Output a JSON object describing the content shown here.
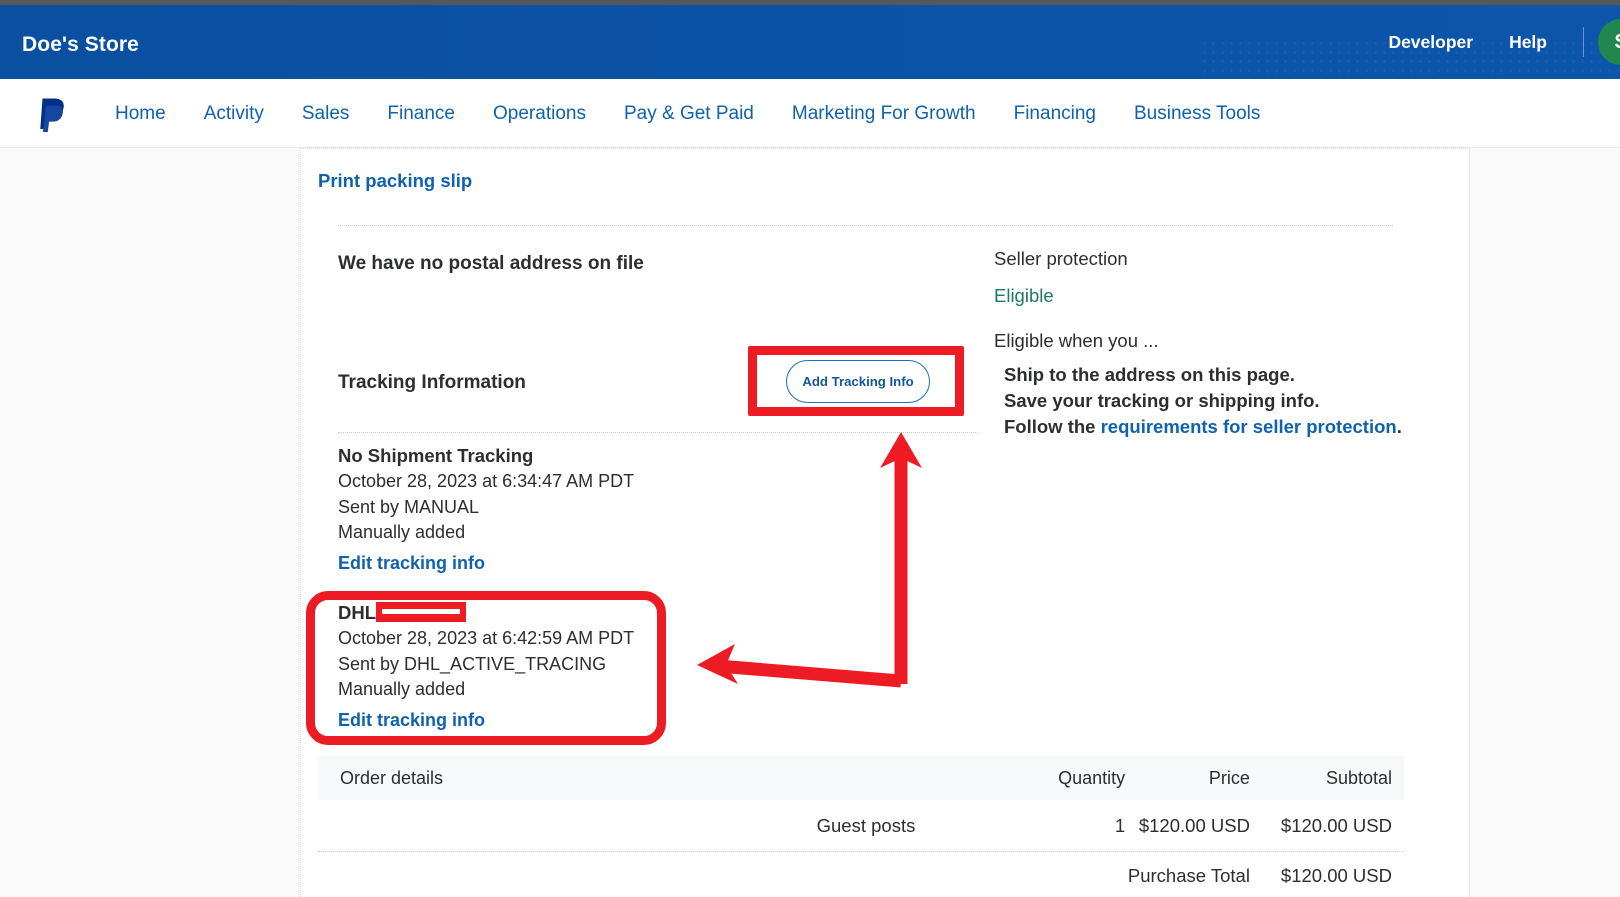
{
  "topbar": {
    "store_name": "Doe's Store",
    "links": [
      {
        "label": "Developer",
        "name": "developer-link"
      },
      {
        "label": "Help",
        "name": "help-link"
      }
    ],
    "avatar_initial": "S",
    "avatar_color": "#21874e",
    "bg_color": "#0b53a6"
  },
  "nav": {
    "logo_icon": "paypal-logo-icon",
    "items": [
      {
        "label": "Home"
      },
      {
        "label": "Activity"
      },
      {
        "label": "Sales"
      },
      {
        "label": "Finance"
      },
      {
        "label": "Operations"
      },
      {
        "label": "Pay & Get Paid"
      },
      {
        "label": "Marketing For Growth"
      },
      {
        "label": "Financing"
      },
      {
        "label": "Business Tools"
      }
    ],
    "link_color": "#0f62ae"
  },
  "main": {
    "print_packing_slip": "Print packing slip",
    "no_postal_address": "We have no postal address on file",
    "tracking_information_title": "Tracking Information",
    "add_tracking_button": "Add Tracking Info",
    "tracking_entries": [
      {
        "carrier": "No Shipment Tracking",
        "timestamp": "October 28, 2023 at 6:34:47 AM PDT",
        "sent_by": "Sent by MANUAL",
        "added": "Manually added",
        "edit_link": "Edit tracking info",
        "redacted": false
      },
      {
        "carrier": "DHL",
        "timestamp": "October 28, 2023 at 6:42:59 AM PDT",
        "sent_by": "Sent by DHL_ACTIVE_TRACING",
        "added": "Manually added",
        "edit_link": "Edit tracking info",
        "redacted": true
      }
    ]
  },
  "seller_protection": {
    "title": "Seller protection",
    "status": "Eligible",
    "status_color": "#1a7a5e",
    "eligible_when": "Eligible when you ...",
    "requirements": [
      {
        "text": "Ship to the address on this page.",
        "link": ""
      },
      {
        "text": "Save your tracking or shipping info.",
        "link": ""
      },
      {
        "text_prefix": "Follow the ",
        "link": "requirements for seller protection",
        "text_suffix": "."
      }
    ]
  },
  "order_details": {
    "headers": {
      "name": "Order details",
      "quantity": "Quantity",
      "price": "Price",
      "subtotal": "Subtotal"
    },
    "rows": [
      {
        "description": "Guest posts",
        "quantity": "1",
        "price": "$120.00 USD",
        "subtotal": "$120.00 USD"
      }
    ],
    "total_label": "Purchase Total",
    "total_value": "$120.00 USD"
  },
  "annotations": {
    "color": "#ed1c24",
    "shapes": [
      {
        "type": "rect",
        "target": "add-tracking-info-button"
      },
      {
        "type": "rounded-rect",
        "target": "dhl-tracking-entry"
      },
      {
        "type": "arrow",
        "from": "add-tracking-info-button",
        "to": "dhl-tracking-entry"
      },
      {
        "type": "redaction-bar",
        "target": "dhl-tracking-number"
      }
    ]
  }
}
